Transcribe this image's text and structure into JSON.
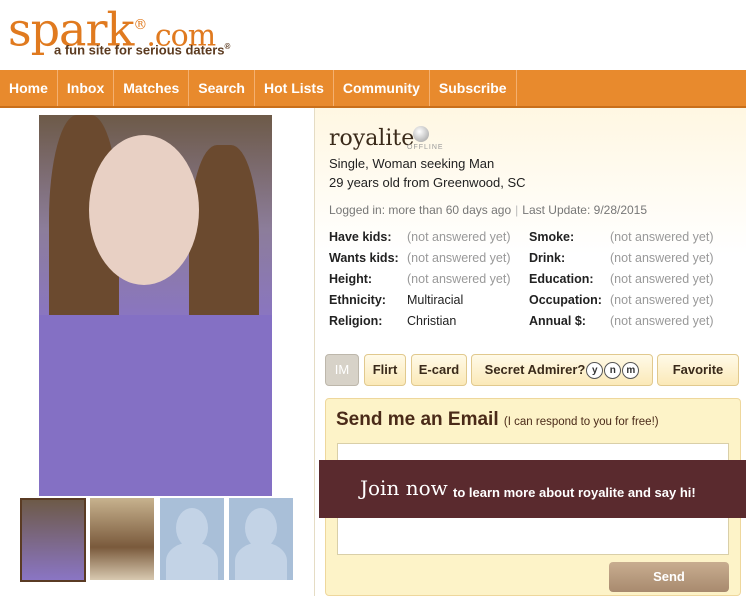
{
  "logo": {
    "main": "spark",
    "reg": "®",
    "com": ".com",
    "tagline": "a fun site for serious daters",
    "tagline_reg": "®"
  },
  "nav": [
    "Home",
    "Inbox",
    "Matches",
    "Search",
    "Hot Lists",
    "Community",
    "Subscribe"
  ],
  "profile": {
    "username": "royalite",
    "status": "OFFLINE",
    "line1": "Single, Woman seeking Man",
    "line2": "29 years old from Greenwood, SC",
    "logged_in": "Logged in: more than 60 days ago",
    "separator": "|",
    "last_update": "Last Update: 9/28/2015"
  },
  "attributes": {
    "left": [
      {
        "label": "Have kids:",
        "value": "(not answered yet)"
      },
      {
        "label": "Wants kids:",
        "value": "(not answered yet)"
      },
      {
        "label": "Height:",
        "value": "(not answered yet)"
      },
      {
        "label": "Ethnicity:",
        "value": "Multiracial"
      },
      {
        "label": "Religion:",
        "value": "Christian"
      }
    ],
    "right": [
      {
        "label": "Smoke:",
        "value": "(not answered yet)"
      },
      {
        "label": "Drink:",
        "value": "(not answered yet)"
      },
      {
        "label": "Education:",
        "value": "(not answered yet)"
      },
      {
        "label": "Occupation:",
        "value": "(not answered yet)"
      },
      {
        "label": "Annual $:",
        "value": "(not answered yet)"
      }
    ]
  },
  "actions": {
    "im": "IM",
    "flirt": "Flirt",
    "ecard": "E-card",
    "secret": "Secret Admirer?",
    "y": "y",
    "n": "n",
    "m": "m",
    "favorite": "Favorite"
  },
  "email": {
    "title": "Send me an Email",
    "subtitle": "(I can respond to you for free!)",
    "send": "Send"
  },
  "join": {
    "big": "Join now",
    "small": "to learn more about royalite and say hi!"
  },
  "colors": {
    "brand_orange": "#e88a2d",
    "join_bg": "#5a2a2e",
    "email_bg": "#fdf3c8"
  }
}
